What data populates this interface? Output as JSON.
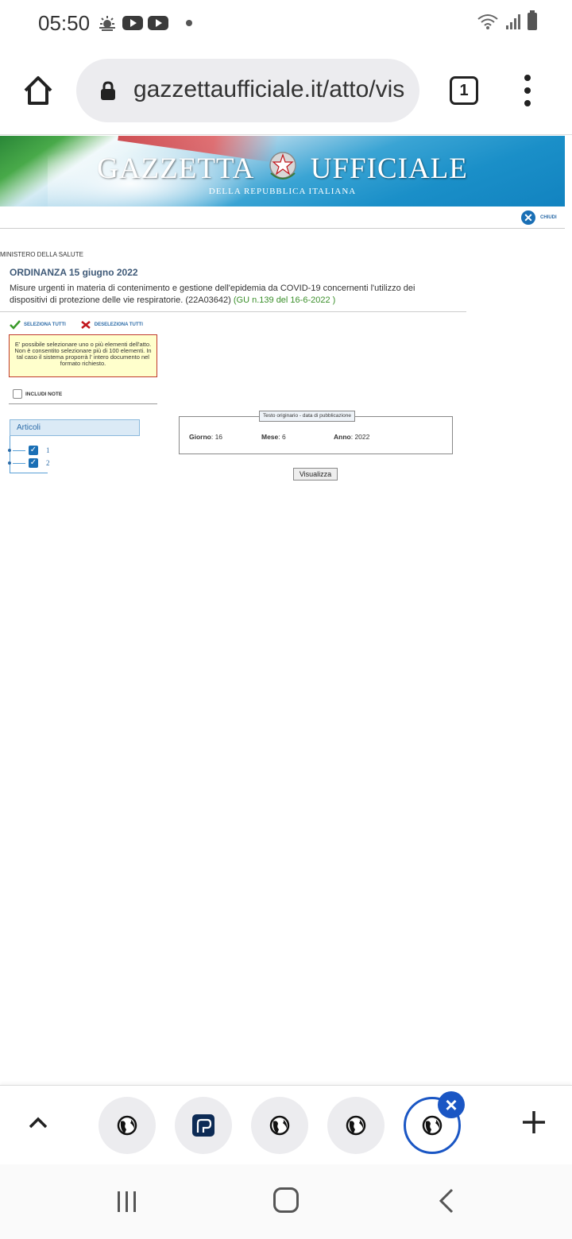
{
  "status_bar": {
    "time": "05:50"
  },
  "browser": {
    "url": "gazzettaufficiale.it/atto/vis",
    "tab_count": "1"
  },
  "banner": {
    "title_left": "GAZZETTA",
    "title_right": "UFFICIALE",
    "subtitle": "DELLA REPUBBLICA ITALIANA"
  },
  "header": {
    "close_label": "CHIUDI"
  },
  "act": {
    "ministry": "MINISTERO DELLA SALUTE",
    "title": "ORDINANZA 15 giugno 2022",
    "description": "Misure urgenti in materia di contenimento e gestione dell'epidemia da COVID-19 concernenti l'utilizzo dei dispositivi di protezione delle vie respiratorie. (22A03642)",
    "gazette_ref": "(GU n.139 del 16-6-2022 )"
  },
  "selection": {
    "select_all": "SELEZIONA TUTTI",
    "deselect_all": "DESELEZIONA TUTTI",
    "warning": "E' possibile selezionare uno o più elementi dell'atto. Non è consentito selezionare più di 100 elementi. In tal caso il sistema proporrà l' intero documento nel formato richiesto.",
    "include_notes": "INCLUDI NOTE"
  },
  "articles": {
    "heading": "Articoli",
    "items": [
      {
        "number": "1",
        "checked": true
      },
      {
        "number": "2",
        "checked": true
      }
    ]
  },
  "publication": {
    "legend": "Testo originario - data di pubblicazione",
    "day_label": "Giorno",
    "day_value": ": 16",
    "month_label": "Mese",
    "month_value": ": 6",
    "year_label": "Anno",
    "year_value": ": 2022",
    "view_button": "Visualizza"
  },
  "tab_strip": {
    "tabs": [
      "globe-icon",
      "app-icon",
      "globe-icon",
      "globe-icon",
      "globe-icon"
    ],
    "active_tab": 4
  },
  "colors": {
    "accent": "#1a56c4",
    "link": "#2d6ca8",
    "gazette_ref": "#3a8f2a",
    "warning_bg": "#ffffcc",
    "warning_border": "#c0392b"
  }
}
